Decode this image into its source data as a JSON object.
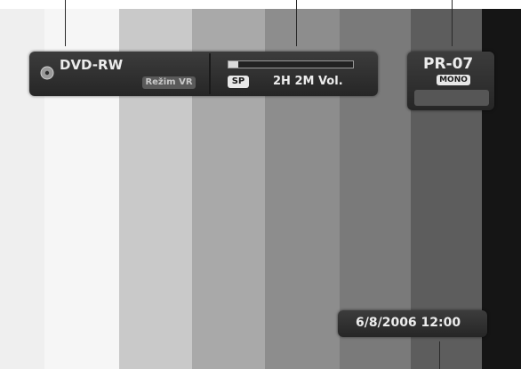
{
  "disc_panel": {
    "disc_type": "DVD-RW",
    "mode_badge": "Režim VR",
    "disc_icon": "disc-icon"
  },
  "recording_panel": {
    "record_mode": "SP",
    "remaining_time": "2H 2M Vol.",
    "space_used_fraction": 0.08
  },
  "channel_panel": {
    "channel": "PR-07",
    "audio": "MONO"
  },
  "clock_panel": {
    "datetime": "6/8/2006 12:00"
  },
  "colors": {
    "panel_bg": "#2e2e2e",
    "text": "#ececec",
    "badge_bg": "#5a5a5a"
  }
}
